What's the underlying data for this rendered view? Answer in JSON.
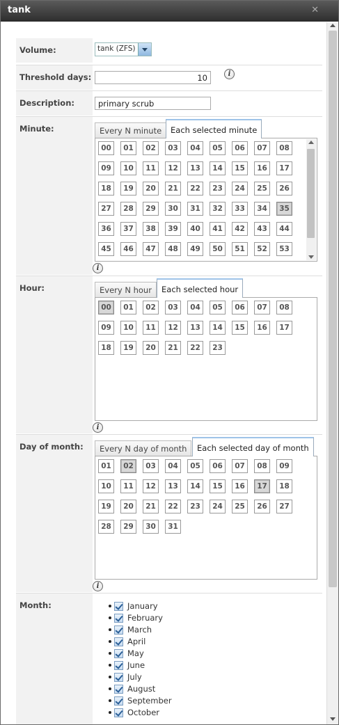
{
  "window": {
    "title": "tank"
  },
  "volume": {
    "label": "Volume:",
    "value": "tank (ZFS)"
  },
  "threshold": {
    "label": "Threshold days:",
    "value": "10"
  },
  "description": {
    "label": "Description:",
    "value": "primary scrub"
  },
  "minute": {
    "label": "Minute:",
    "tabs": [
      "Every N minute",
      "Each selected minute"
    ],
    "active_tab": 1,
    "cells": [
      "00",
      "01",
      "02",
      "03",
      "04",
      "05",
      "06",
      "07",
      "08",
      "09",
      "10",
      "11",
      "12",
      "13",
      "14",
      "15",
      "16",
      "17",
      "18",
      "19",
      "20",
      "21",
      "22",
      "23",
      "24",
      "25",
      "26",
      "27",
      "28",
      "29",
      "30",
      "31",
      "32",
      "33",
      "34",
      "35",
      "36",
      "37",
      "38",
      "39",
      "40",
      "41",
      "42",
      "43",
      "44",
      "45",
      "46",
      "47",
      "48",
      "49",
      "50",
      "51",
      "52",
      "53"
    ],
    "selected": [
      "35"
    ]
  },
  "hour": {
    "label": "Hour:",
    "tabs": [
      "Every N hour",
      "Each selected hour"
    ],
    "active_tab": 1,
    "cells": [
      "00",
      "01",
      "02",
      "03",
      "04",
      "05",
      "06",
      "07",
      "08",
      "09",
      "10",
      "11",
      "12",
      "13",
      "14",
      "15",
      "16",
      "17",
      "18",
      "19",
      "20",
      "21",
      "22",
      "23"
    ],
    "selected": [
      "00"
    ]
  },
  "day_of_month": {
    "label": "Day of month:",
    "tabs": [
      "Every N day of month",
      "Each selected day of month"
    ],
    "active_tab": 1,
    "cells": [
      "01",
      "02",
      "03",
      "04",
      "05",
      "06",
      "07",
      "08",
      "09",
      "10",
      "11",
      "12",
      "13",
      "14",
      "15",
      "16",
      "17",
      "18",
      "19",
      "20",
      "21",
      "22",
      "23",
      "24",
      "25",
      "26",
      "27",
      "28",
      "29",
      "30",
      "31"
    ],
    "selected": [
      "02",
      "17"
    ]
  },
  "month": {
    "label": "Month:",
    "items": [
      "January",
      "February",
      "March",
      "April",
      "May",
      "June",
      "July",
      "August",
      "September",
      "October"
    ],
    "checked": [
      true,
      true,
      true,
      true,
      true,
      true,
      true,
      true,
      true,
      true
    ]
  },
  "icons": {
    "close": "close-icon",
    "info": "info-icon",
    "dropdown": "chevron-down-icon",
    "checkbox": "checkbox-checked-icon"
  },
  "colors": {
    "titlebar": "#3a3a3a",
    "selected_cell": "#d8d8d8",
    "tab_accent": "#9ec3e8"
  }
}
